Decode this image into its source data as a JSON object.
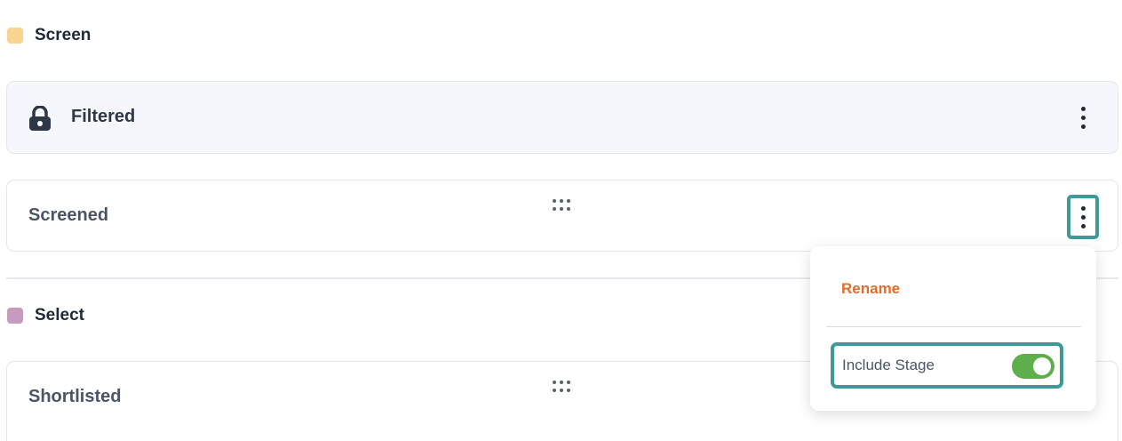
{
  "groups": [
    {
      "title": "Screen",
      "color": "#f8d48f",
      "stages": [
        {
          "label": "Filtered",
          "locked": true,
          "icon": "lock-icon"
        },
        {
          "label": "Screened",
          "locked": false,
          "icon": "drag-handle-icon"
        }
      ]
    },
    {
      "title": "Select",
      "color": "#c79bbf",
      "stages": [
        {
          "label": "Shortlisted",
          "locked": false,
          "icon": "drag-handle-icon"
        }
      ]
    }
  ],
  "stage_menu": {
    "rename_label": "Rename",
    "include_stage_label": "Include Stage",
    "include_stage_enabled": true
  },
  "colors": {
    "accent_orange": "#e06c2d",
    "highlight_teal": "#3d9a98",
    "toggle_on": "#5fae4c"
  }
}
